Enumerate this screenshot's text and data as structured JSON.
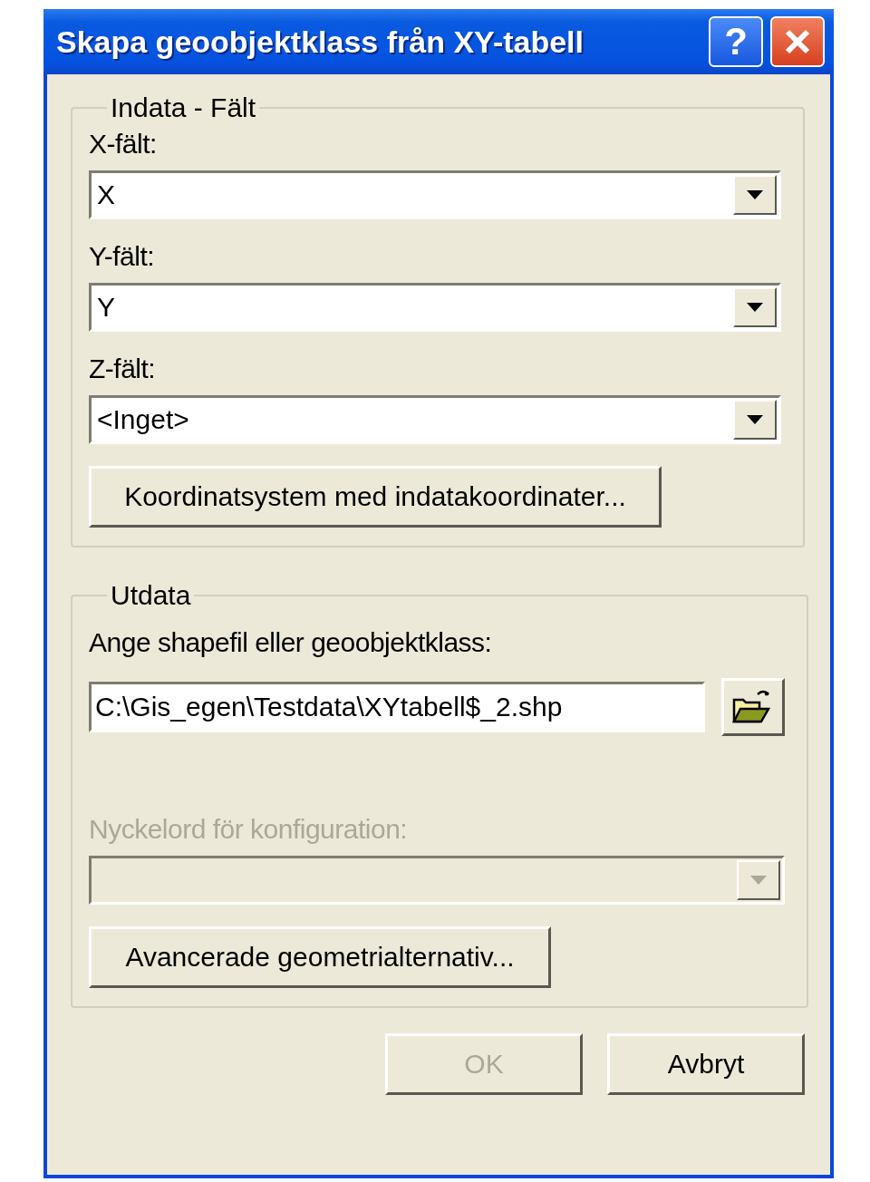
{
  "window": {
    "title": "Skapa geoobjektklass från XY-tabell",
    "help_label": "?"
  },
  "input_group": {
    "legend": "Indata - Fält",
    "fields": [
      {
        "label": "X-fält:",
        "value": "X"
      },
      {
        "label": "Y-fält:",
        "value": "Y"
      },
      {
        "label": "Z-fält:",
        "value": "<Inget>"
      }
    ],
    "button": "Koordinatsystem med indatakoordinater..."
  },
  "output_group": {
    "legend": "Utdata",
    "prompt": "Ange shapefil eller geoobjektklass:",
    "path": "C:\\Gis_egen\\Testdata\\XYtabell$_2.shp",
    "keyword": {
      "label": "Nyckelord för konfiguration:",
      "disabled": true
    },
    "button": "Avancerade geometrialternativ..."
  },
  "buttons": [
    {
      "label": "OK",
      "disabled": true
    },
    {
      "label": "Avbryt",
      "disabled": false
    }
  ]
}
